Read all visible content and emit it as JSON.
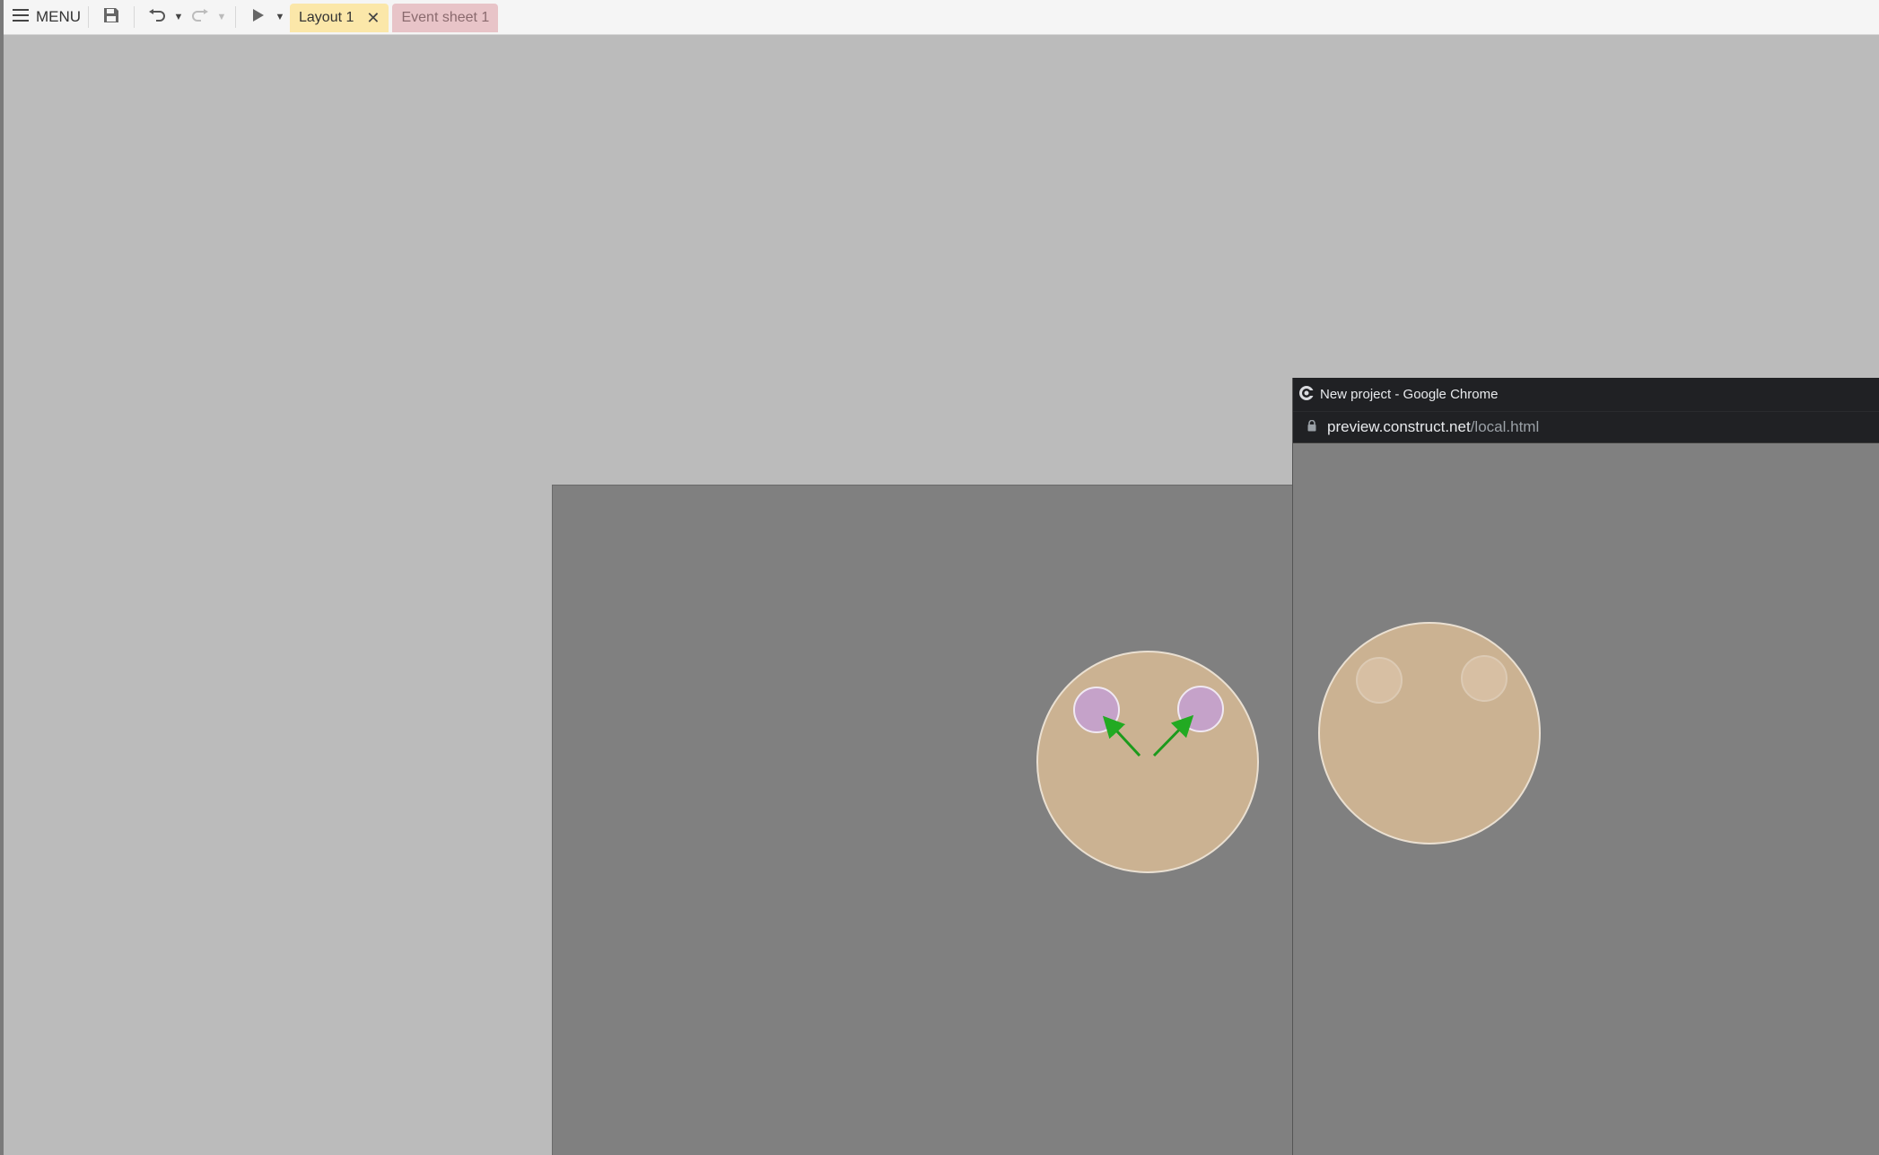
{
  "toolbar": {
    "menu_label": "MENU",
    "tabs": [
      {
        "label": "Layout 1",
        "active": true
      },
      {
        "label": "Event sheet 1",
        "active": false
      }
    ],
    "close_glyph": "✕"
  },
  "icons": [
    "hamburger-icon",
    "save-icon",
    "undo-icon",
    "redo-icon",
    "play-icon",
    "chrome-logo-icon",
    "lock-icon",
    "arrow-icon"
  ],
  "colors": {
    "toolbar_bg": "#f5f5f5",
    "workspace_bg": "#bbbbbb",
    "layout_bg": "#808080",
    "face": "#cbb292",
    "eye_selected": "#c5a2c9",
    "arrow": "#22aa22",
    "layout_tab": "#fbe7a9",
    "event_tab": "#e8c4c8",
    "chrome_bar": "#202124"
  },
  "browser": {
    "window_title": "New project - Google Chrome",
    "url_host": "preview.construct.net",
    "url_path": "/local.html"
  }
}
